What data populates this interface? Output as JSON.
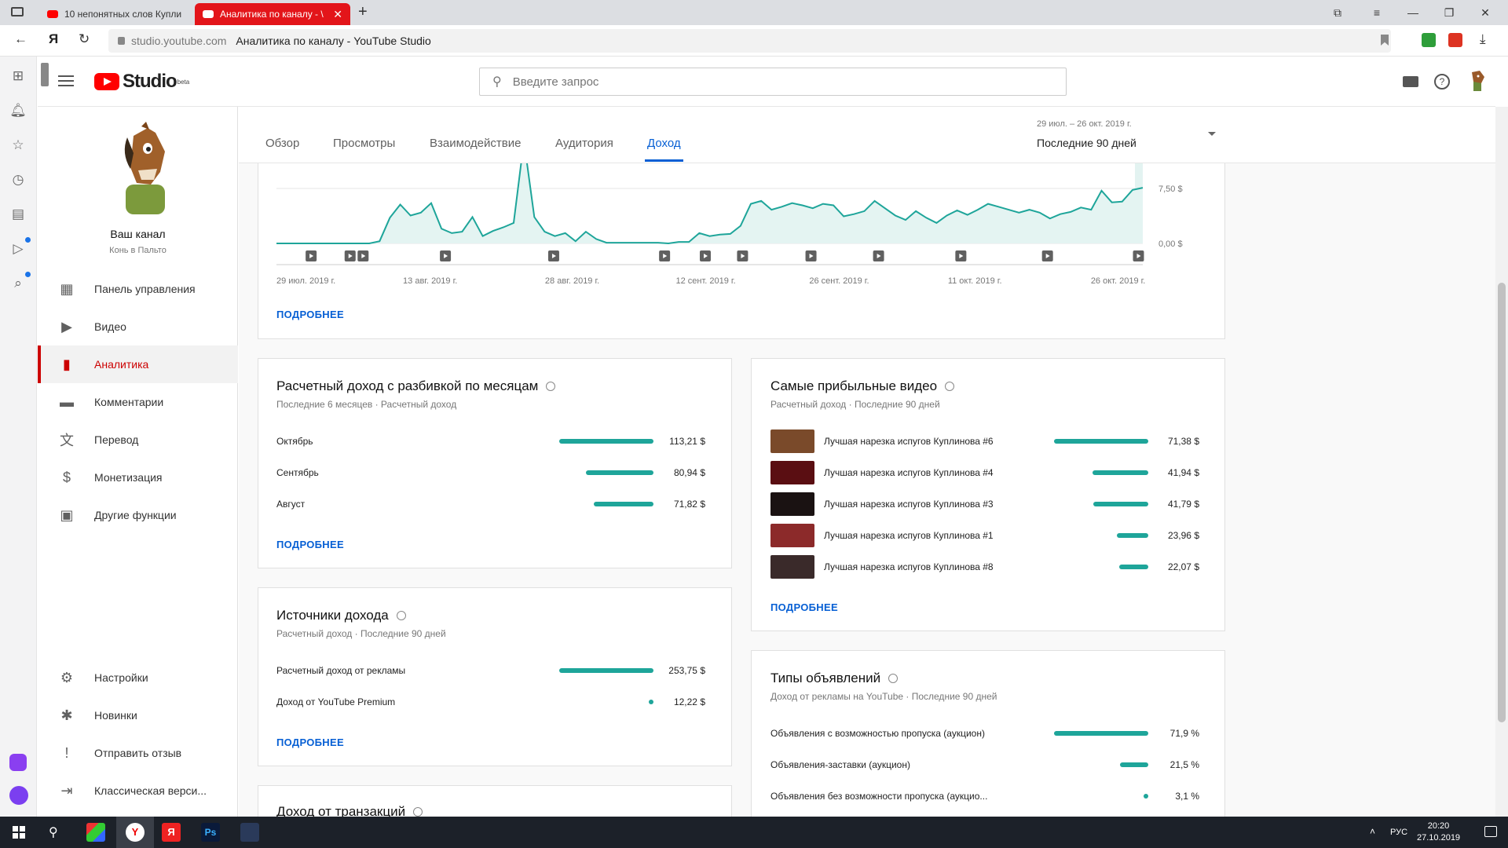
{
  "browser": {
    "tabs": [
      {
        "title": "10 непонятных слов Купли"
      },
      {
        "title": "Аналитика по каналу - \\"
      }
    ],
    "url_domain": "studio.youtube.com",
    "page_title": "Аналитика по каналу - YouTube Studio"
  },
  "header": {
    "logo_text": "Studio",
    "logo_badge": "beta",
    "search_placeholder": "Введите запрос"
  },
  "sidebar": {
    "channel_name": "Ваш канал",
    "channel_handle": "Конь в Пальто",
    "items": [
      {
        "label": "Панель управления",
        "icon": "dashboard-icon"
      },
      {
        "label": "Видео",
        "icon": "video-library-icon"
      },
      {
        "label": "Аналитика",
        "icon": "analytics-icon",
        "active": true
      },
      {
        "label": "Комментарии",
        "icon": "comment-icon"
      },
      {
        "label": "Перевод",
        "icon": "translate-icon"
      },
      {
        "label": "Монетизация",
        "icon": "dollar-icon"
      },
      {
        "label": "Другие функции",
        "icon": "other-features-icon"
      }
    ],
    "bottom_items": [
      {
        "label": "Настройки",
        "icon": "gear-icon"
      },
      {
        "label": "Новинки",
        "icon": "news-icon"
      },
      {
        "label": "Отправить отзыв",
        "icon": "feedback-icon"
      },
      {
        "label": "Классическая верси...",
        "icon": "exit-icon"
      }
    ]
  },
  "analytics": {
    "tabs": [
      "Обзор",
      "Просмотры",
      "Взаимодействие",
      "Аудитория",
      "Доход"
    ],
    "selected_tab": "Доход",
    "range_dates": "29 июл. – 26 окт. 2019 г.",
    "range_label": "Последние 90 дней",
    "more_label": "ПОДРОБНЕЕ"
  },
  "chart_data": {
    "type": "area",
    "x_tick_labels": [
      "29 июл. 2019 г.",
      "13 авг. 2019 г.",
      "28 авг. 2019 г.",
      "12 сент. 2019 г.",
      "26 сент. 2019 г.",
      "11 окт. 2019 г.",
      "26 окт. 2019 г."
    ],
    "y_tick_labels": [
      "7,50 $",
      "0,00 $"
    ],
    "ylim": [
      0,
      10
    ],
    "values": [
      0,
      0,
      0,
      0,
      0,
      0,
      0,
      0,
      0,
      0,
      0.3,
      3.5,
      5.3,
      3.8,
      4.2,
      5.5,
      2.0,
      1.4,
      1.6,
      3.6,
      1.0,
      1.7,
      2.2,
      2.8,
      14,
      3.6,
      1.6,
      1.0,
      1.4,
      0.3,
      1.6,
      0.6,
      0.1,
      0.1,
      0.1,
      0.1,
      0.1,
      0.1,
      0,
      0.2,
      0.2,
      1.4,
      1.0,
      1.2,
      1.3,
      2.4,
      5.4,
      5.8,
      4.6,
      5.0,
      5.5,
      5.2,
      4.8,
      5.4,
      5.2,
      3.7,
      4.0,
      4.4,
      5.8,
      4.8,
      3.8,
      3.2,
      4.4,
      3.5,
      2.8,
      3.8,
      4.5,
      3.9,
      4.6,
      5.4,
      5.0,
      4.6,
      4.2,
      4.6,
      4.2,
      3.4,
      4.0,
      4.3,
      4.9,
      4.6,
      7.2,
      5.6,
      5.7,
      7.3,
      7.6
    ],
    "markers": 13,
    "grid": true
  },
  "monthly_revenue": {
    "title": "Расчетный доход с разбивкой по месяцам",
    "subtitle": "Последние 6 месяцев · Расчетный доход",
    "rows": [
      {
        "label": "Октябрь",
        "value": "113,21 $",
        "fraction": 1.0
      },
      {
        "label": "Сентябрь",
        "value": "80,94 $",
        "fraction": 0.715
      },
      {
        "label": "Август",
        "value": "71,82 $",
        "fraction": 0.634
      }
    ]
  },
  "top_videos": {
    "title": "Самые прибыльные видео",
    "subtitle": "Расчетный доход · Последние 90 дней",
    "rows": [
      {
        "label": "Лучшая нарезка испугов Куплинова #6",
        "value": "71,38 $",
        "fraction": 1.0,
        "thumb_color": "#7a4a2a"
      },
      {
        "label": "Лучшая нарезка испугов Куплинова #4",
        "value": "41,94 $",
        "fraction": 0.588,
        "thumb_color": "#5a0e12"
      },
      {
        "label": "Лучшая нарезка испугов Куплинова #3",
        "value": "41,79 $",
        "fraction": 0.585,
        "thumb_color": "#1a1212"
      },
      {
        "label": "Лучшая нарезка испугов Куплинова #1",
        "value": "23,96 $",
        "fraction": 0.336,
        "thumb_color": "#8c2a2a"
      },
      {
        "label": "Лучшая нарезка испугов Куплинова #8",
        "value": "22,07 $",
        "fraction": 0.309,
        "thumb_color": "#3a2a2a"
      }
    ]
  },
  "revenue_sources": {
    "title": "Источники дохода",
    "subtitle": "Расчетный доход · Последние 90 дней",
    "rows": [
      {
        "label": "Расчетный доход от рекламы",
        "value": "253,75 $",
        "fraction": 1.0
      },
      {
        "label": "Доход от YouTube Premium",
        "value": "12,22 $",
        "fraction": 0.048
      }
    ]
  },
  "ad_types": {
    "title": "Типы объявлений",
    "subtitle": "Доход от рекламы на YouTube · Последние 90 дней",
    "rows": [
      {
        "label": "Объявления с возможностью пропуска (аукцион)",
        "value": "71,9 %",
        "fraction": 1.0
      },
      {
        "label": "Объявления-заставки (аукцион)",
        "value": "21,5 %",
        "fraction": 0.3
      },
      {
        "label": "Объявления без возможности пропуска (аукцио...",
        "value": "3,1 %",
        "fraction": 0.043
      }
    ]
  },
  "transactions": {
    "title": "Доход от транзакций"
  },
  "taskbar": {
    "lang": "РУС",
    "time": "20:20",
    "date": "27.10.2019"
  },
  "colors": {
    "accent": "#065fd4",
    "bar": "#1ea59a",
    "active_nav": "#cc0000",
    "tab_active": "#e3151a"
  }
}
